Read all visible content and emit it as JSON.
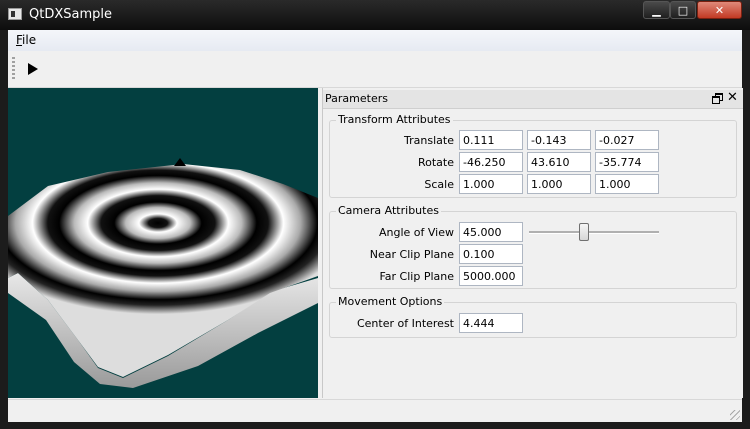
{
  "window": {
    "title": "QtDXSample"
  },
  "menu": {
    "file_label": "File",
    "file_mnemonic": "F",
    "file_rest": "ile"
  },
  "toolbar": {
    "play_icon": "play-icon"
  },
  "dock": {
    "title": "Parameters",
    "transform": {
      "title": "Transform Attributes",
      "rows": [
        {
          "label": "Translate",
          "values": [
            "0.111",
            "-0.143",
            "-0.027"
          ]
        },
        {
          "label": "Rotate",
          "values": [
            "-46.250",
            "43.610",
            "-35.774"
          ]
        },
        {
          "label": "Scale",
          "values": [
            "1.000",
            "1.000",
            "1.000"
          ]
        }
      ]
    },
    "camera": {
      "title": "Camera Attributes",
      "angle_label": "Angle of View",
      "angle_value": "45.000",
      "angle_slider_fraction": 0.42,
      "near_label": "Near Clip Plane",
      "near_value": "0.100",
      "far_label": "Far Clip Plane",
      "far_value": "5000.000"
    },
    "movement": {
      "title": "Movement Options",
      "coi_label": "Center of Interest",
      "coi_value": "4.444"
    }
  },
  "colors": {
    "viewport_bg": "#033f40",
    "close_button": "#c23a24"
  }
}
